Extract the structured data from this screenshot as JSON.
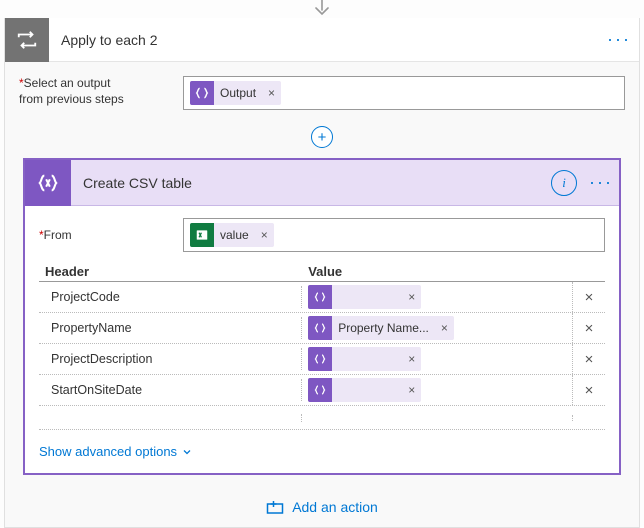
{
  "applyAction": {
    "title": "Apply to each 2"
  },
  "param": {
    "label_line1": "Select an output",
    "label_line2": "from previous steps",
    "tokenLabel": "Output"
  },
  "csvAction": {
    "title": "Create CSV table",
    "fromLabel": "From",
    "fromTokenLabel": "value",
    "headerCol": "Header",
    "valueCol": "Value",
    "rows": [
      {
        "header": "ProjectCode",
        "valueLabel": ""
      },
      {
        "header": "PropertyName",
        "valueLabel": "Property Name..."
      },
      {
        "header": "ProjectDescription",
        "valueLabel": ""
      },
      {
        "header": "StartOnSiteDate",
        "valueLabel": ""
      }
    ],
    "showAdvanced": "Show advanced options"
  },
  "addAction": "Add an action"
}
